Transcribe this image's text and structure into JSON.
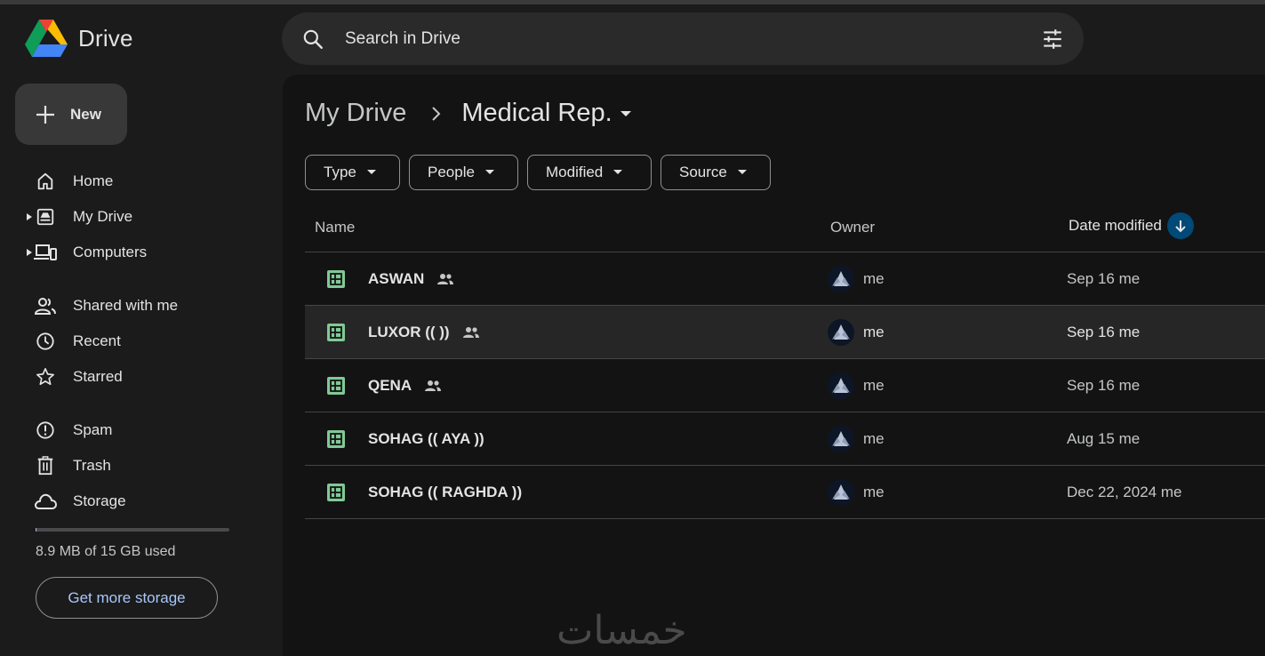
{
  "app": {
    "name": "Drive"
  },
  "search": {
    "placeholder": "Search in Drive"
  },
  "new_button": {
    "label": "New"
  },
  "sidebar": {
    "items": [
      {
        "label": "Home",
        "icon": "home-icon"
      },
      {
        "label": "My Drive",
        "icon": "my-drive-icon"
      },
      {
        "label": "Computers",
        "icon": "computers-icon"
      },
      {
        "label": "Shared with me",
        "icon": "shared-icon"
      },
      {
        "label": "Recent",
        "icon": "clock-icon"
      },
      {
        "label": "Starred",
        "icon": "star-icon"
      },
      {
        "label": "Spam",
        "icon": "spam-icon"
      },
      {
        "label": "Trash",
        "icon": "trash-icon"
      },
      {
        "label": "Storage",
        "icon": "cloud-icon"
      }
    ],
    "storage": {
      "used_text": "8.9 MB of 15 GB used",
      "used_fraction": 0.0006,
      "button": "Get more storage"
    }
  },
  "breadcrumb": {
    "parent": "My Drive",
    "current": "Medical Rep."
  },
  "filters": [
    "Type",
    "People",
    "Modified",
    "Source"
  ],
  "table": {
    "headers": {
      "name": "Name",
      "owner": "Owner",
      "modified": "Date modified"
    },
    "rows": [
      {
        "name": "ASWAN",
        "owner": "me",
        "modified": "Sep 16 me",
        "shared": true
      },
      {
        "name": "LUXOR (( ))",
        "owner": "me",
        "modified": "Sep 16 me",
        "shared": true
      },
      {
        "name": "QENA",
        "owner": "me",
        "modified": "Sep 16 me",
        "shared": true
      },
      {
        "name": "SOHAG (( AYA ))",
        "owner": "me",
        "modified": "Aug 15 me",
        "shared": false
      },
      {
        "name": "SOHAG (( RAGHDA ))",
        "owner": "me",
        "modified": "Dec 22, 2024 me",
        "shared": false
      }
    ]
  },
  "watermark": "خمسات",
  "colors": {
    "accent": "#a8c7fa",
    "sheets_green": "#81c995",
    "sort_badge": "#004a77"
  }
}
